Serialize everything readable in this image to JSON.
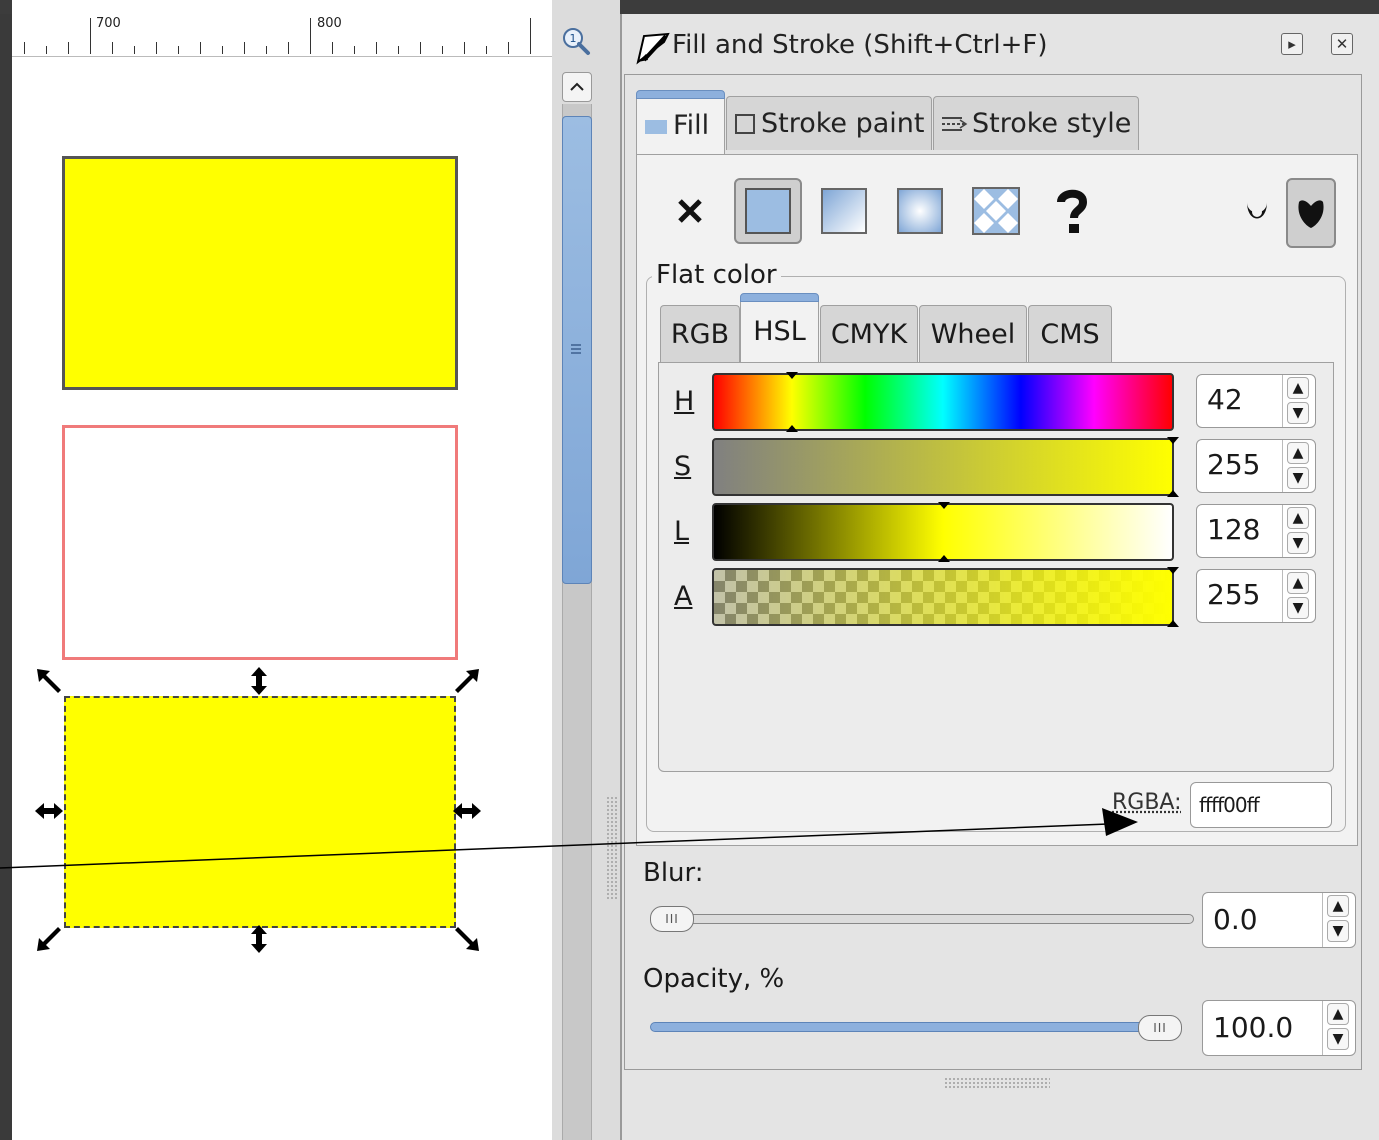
{
  "ruler": {
    "labels": [
      "700",
      "800"
    ]
  },
  "dialog": {
    "title": "Fill and Stroke (Shift+Ctrl+F)",
    "tabs": [
      {
        "label": "Fill",
        "active": true
      },
      {
        "label": "Stroke paint",
        "active": false
      },
      {
        "label": "Stroke style",
        "active": false
      }
    ],
    "paint_types": [
      "no-paint",
      "flat-color",
      "linear-gradient",
      "radial-gradient",
      "pattern",
      "unset"
    ],
    "fill_rules": [
      "fill-rule-evenodd",
      "fill-rule-nonzero"
    ],
    "flat_color_label": "Flat color",
    "color_tabs": [
      {
        "label": "RGB",
        "active": false
      },
      {
        "label": "HSL",
        "active": true
      },
      {
        "label": "CMYK",
        "active": false
      },
      {
        "label": "Wheel",
        "active": false
      },
      {
        "label": "CMS",
        "active": false
      }
    ],
    "channels": [
      {
        "label": "H",
        "value": "42"
      },
      {
        "label": "S",
        "value": "255"
      },
      {
        "label": "L",
        "value": "128"
      },
      {
        "label": "A",
        "value": "255"
      }
    ],
    "rgba_label": "RGBA:",
    "rgba_value": "ffff00ff",
    "blur_label": "Blur:",
    "blur_value": "0.0",
    "opacity_label": "Opacity, %",
    "opacity_value": "100.0"
  },
  "colors": {
    "fill": "#ffff00",
    "stroke_top": "#555555",
    "stroke_mid": "#f07a7a",
    "accent": "#8db0dd"
  }
}
